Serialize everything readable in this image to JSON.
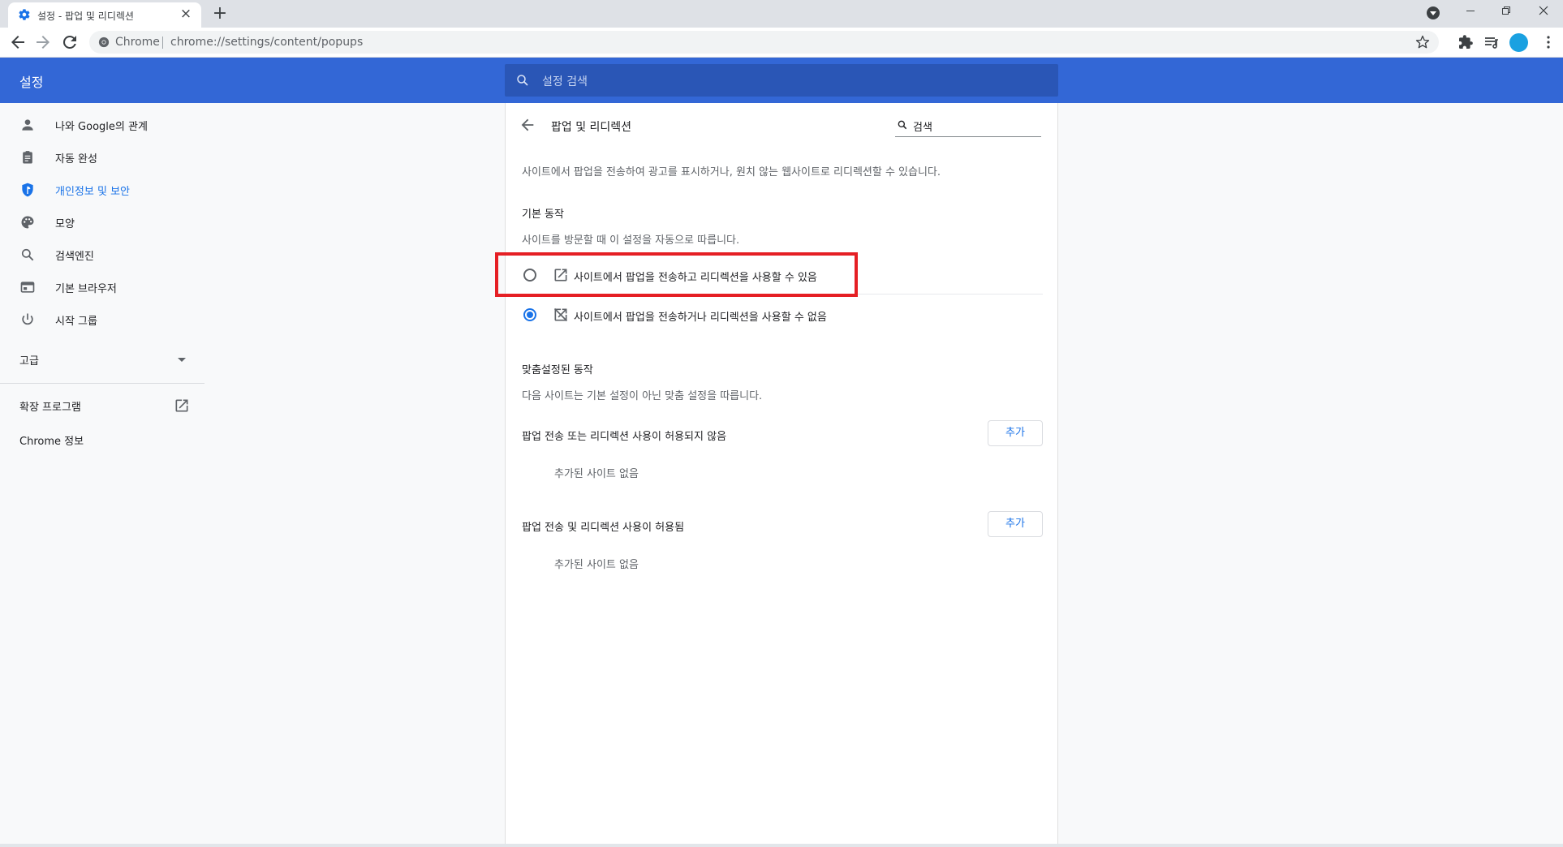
{
  "browser": {
    "tab": {
      "title": "설정 - 팝업 및 리디렉션",
      "icon": "gear-icon"
    },
    "window_controls": [
      "minimize",
      "restore",
      "close"
    ],
    "omnibox": {
      "scheme_label": "Chrome",
      "url": "chrome://settings/content/popups"
    },
    "toolbar_icons": [
      "back-icon",
      "forward-icon",
      "reload-icon",
      "star-icon",
      "extensions-icon",
      "reading-list-icon",
      "avatar",
      "more-icon"
    ]
  },
  "header": {
    "title": "설정",
    "search_placeholder": "설정 검색",
    "brand_color": "#3367d6"
  },
  "sidebar": {
    "items": [
      {
        "label": "나와 Google의 관계",
        "icon": "person-icon",
        "active": false
      },
      {
        "label": "자동 완성",
        "icon": "clipboard-icon",
        "active": false
      },
      {
        "label": "개인정보 및 보안",
        "icon": "shield-icon",
        "active": true
      },
      {
        "label": "모양",
        "icon": "palette-icon",
        "active": false
      },
      {
        "label": "검색엔진",
        "icon": "search-icon",
        "active": false
      },
      {
        "label": "기본 브라우저",
        "icon": "browser-icon",
        "active": false
      },
      {
        "label": "시작 그룹",
        "icon": "power-icon",
        "active": false
      }
    ],
    "advanced_label": "고급",
    "extensions_label": "확장 프로그램",
    "about_label": "Chrome 정보"
  },
  "main": {
    "title": "팝업 및 리디렉션",
    "search_text": "검색",
    "description": "사이트에서 팝업을 전송하여 광고를 표시하거나, 원치 않는 웹사이트로 리디렉션할 수 있습니다.",
    "default_behavior": {
      "title": "기본 동작",
      "subtitle": "사이트를 방문할 때 이 설정을 자동으로 따릅니다.",
      "options": [
        {
          "label": "사이트에서 팝업을 전송하고 리디렉션을 사용할 수 있음",
          "checked": false,
          "icon": "open-in-new-icon"
        },
        {
          "label": "사이트에서 팝업을 전송하거나 리디렉션을 사용할 수 없음",
          "checked": true,
          "icon": "popup-blocked-icon"
        }
      ]
    },
    "custom_behavior": {
      "title": "맞춤설정된 동작",
      "subtitle": "다음 사이트는 기본 설정이 아닌 맞춤 설정을 따릅니다.",
      "lists": [
        {
          "label": "팝업 전송 또는 리디렉션 사용이 허용되지 않음",
          "add_label": "추가",
          "empty_text": "추가된 사이트 없음"
        },
        {
          "label": "팝업 전송 및 리디렉션 사용이 허용됨",
          "add_label": "추가",
          "empty_text": "추가된 사이트 없음"
        }
      ]
    },
    "highlight_color": "#e51f24"
  }
}
